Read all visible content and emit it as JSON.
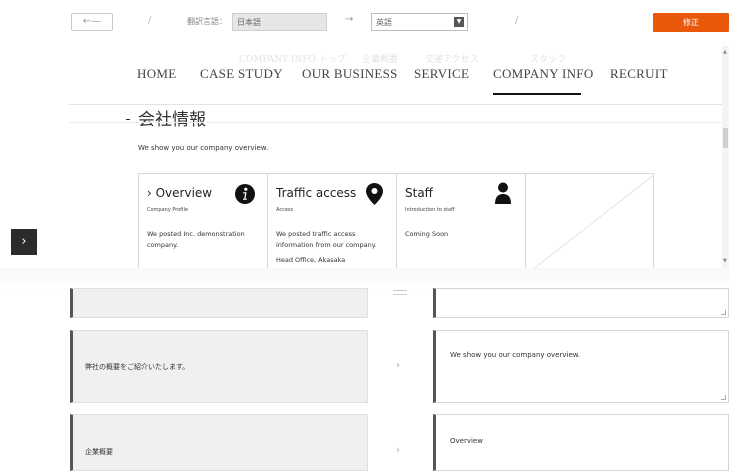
{
  "toolbar": {
    "back_label": "←—",
    "source_language_label": "翻訳言語：",
    "source_language_value": "日本語",
    "arrow": "→",
    "target_language_value": "英語",
    "submit_label": "修正",
    "accent_color": "#e8590c"
  },
  "preview": {
    "ghost_labels": [
      "COMPANY INFO トップ",
      "企業概要",
      "交通アクセス",
      "スタッフ"
    ],
    "nav": [
      "HOME",
      "CASE STUDY",
      "OUR BUSINESS",
      "SERVICE",
      "COMPANY INFO",
      "RECRUIT"
    ],
    "active_nav": "COMPANY INFO",
    "page_title": "会社情報",
    "intro": "We show you our company overview.",
    "cards": [
      {
        "title": "› Overview",
        "subtitle": "Company Profile",
        "body": "We posted Inc. demonstration company.",
        "icon": "info-icon"
      },
      {
        "title": "Traffic access",
        "subtitle": "Access",
        "body": "We posted traffic access information from our company.",
        "extra": "Head Office, Akasaka",
        "icon": "map-pin-icon"
      },
      {
        "title": "Staff",
        "subtitle": "Introduction to staff",
        "body": "Coming Soon",
        "icon": "person-icon"
      }
    ]
  },
  "side_arrow": "›",
  "rows": [
    {
      "source": "",
      "target": ""
    },
    {
      "source": "弊社の概要をご紹介いたします。",
      "target": "We show you our company overview."
    },
    {
      "source": "企業概要",
      "target": "Overview"
    }
  ],
  "row_arrow": "›"
}
